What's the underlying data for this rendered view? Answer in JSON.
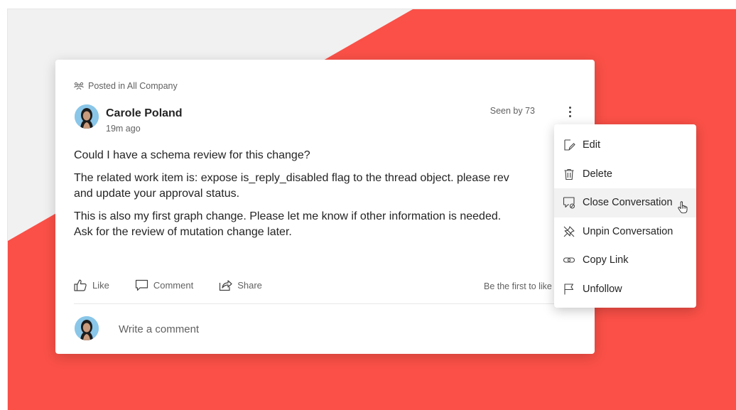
{
  "post": {
    "posted_in": "Posted in All Company",
    "author": "Carole Poland",
    "time_ago": "19m ago",
    "seen_by": "Seen by 73",
    "paragraphs": [
      "Could I have a schema review for this change?",
      "The related work item is: expose is_reply_disabled flag to the thread object. please rev",
      "and update your approval status.",
      "This is also my first graph change. Please let me know if other information is needed.",
      "Ask for the review of mutation change later."
    ],
    "actions": {
      "like": "Like",
      "comment": "Comment",
      "share": "Share"
    },
    "be_first": "Be the first to like",
    "comment_placeholder": "Write a comment"
  },
  "menu": {
    "items": [
      {
        "label": "Edit",
        "icon": "edit-icon"
      },
      {
        "label": "Delete",
        "icon": "trash-icon"
      },
      {
        "label": "Close Conversation",
        "icon": "close-conversation-icon",
        "hovered": true
      },
      {
        "label": "Unpin Conversation",
        "icon": "unpin-icon"
      },
      {
        "label": "Copy Link",
        "icon": "link-icon"
      },
      {
        "label": "Unfollow",
        "icon": "flag-icon"
      }
    ]
  },
  "colors": {
    "accent_red": "#fa5047",
    "avatar_bg": "#8ac6e8",
    "text_primary": "#242424",
    "text_secondary": "#616161"
  }
}
